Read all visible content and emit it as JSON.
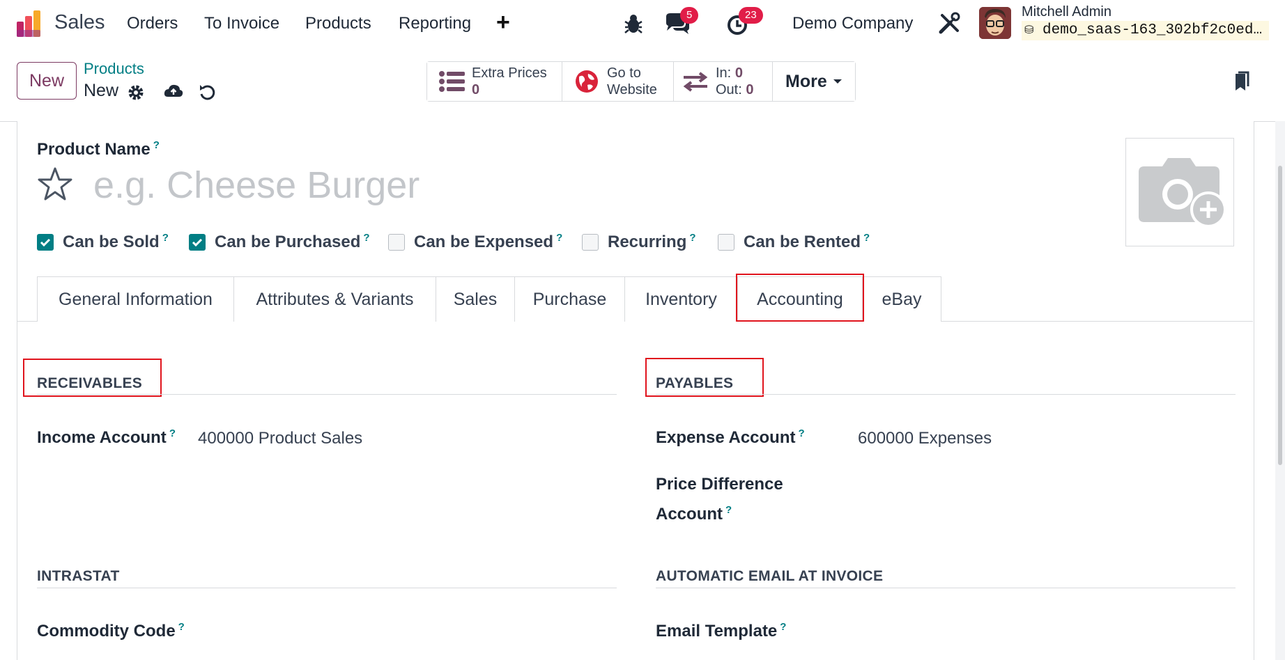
{
  "navbar": {
    "app_name": "Sales",
    "menu": [
      "Orders",
      "To Invoice",
      "Products",
      "Reporting"
    ],
    "plus_label": "+",
    "messages_count": "5",
    "activities_count": "23",
    "company": "Demo Company",
    "user_name": "Mitchell Admin",
    "database": "demo_saas-163_302bf2c0ed…"
  },
  "control_panel": {
    "new_label": "New",
    "breadcrumb_parent": "Products",
    "breadcrumb_current": "New",
    "smart_buttons": {
      "extra_prices_label": "Extra Prices",
      "extra_prices_value": "0",
      "website_line1": "Go to",
      "website_line2": "Website",
      "in_label": "In:",
      "in_value": "0",
      "out_label": "Out:",
      "out_value": "0",
      "more_label": "More"
    }
  },
  "form": {
    "product_name_label": "Product Name",
    "help_mark": "?",
    "product_name_placeholder": "e.g. Cheese Burger",
    "checkboxes": [
      {
        "label": "Can be Sold",
        "checked": true
      },
      {
        "label": "Can be Purchased",
        "checked": true
      },
      {
        "label": "Can be Expensed",
        "checked": false
      },
      {
        "label": "Recurring",
        "checked": false
      },
      {
        "label": "Can be Rented",
        "checked": false
      }
    ],
    "tabs": [
      "General Information",
      "Attributes & Variants",
      "Sales",
      "Purchase",
      "Inventory",
      "Accounting",
      "eBay"
    ],
    "active_tab": "Accounting",
    "receivables": {
      "title": "RECEIVABLES",
      "income_account_label": "Income Account",
      "income_account_value": "400000 Product Sales"
    },
    "payables": {
      "title": "PAYABLES",
      "expense_account_label": "Expense Account",
      "expense_account_value": "600000 Expenses",
      "price_diff_label_line1": "Price Difference",
      "price_diff_label_line2": "Account"
    },
    "intrastat": {
      "title": "INTRASTAT",
      "commodity_code_label": "Commodity Code"
    },
    "auto_email": {
      "title": "AUTOMATIC EMAIL AT INVOICE",
      "email_template_label": "Email Template"
    }
  },
  "colors": {
    "brand": "#714b67",
    "accent": "#017e84",
    "badge": "#e11d48",
    "highlight_box": "#e0141d"
  }
}
